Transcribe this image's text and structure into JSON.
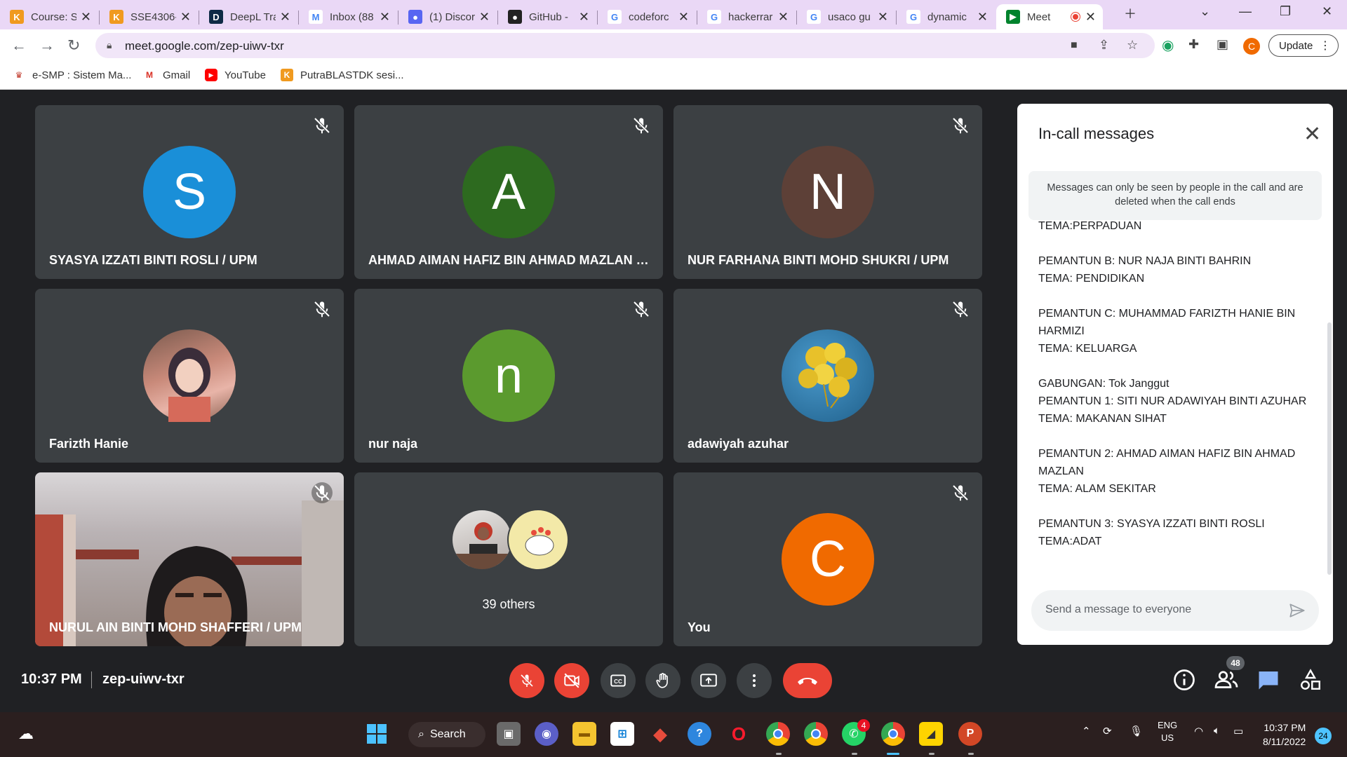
{
  "browser": {
    "tabs": [
      {
        "label": "Course: S",
        "favicon": "K",
        "color": "#f09a1f"
      },
      {
        "label": "SSE4306-",
        "favicon": "K",
        "color": "#f09a1f"
      },
      {
        "label": "DeepL Tra",
        "favicon": "D",
        "color": "#0f2b46"
      },
      {
        "label": "Inbox (88",
        "favicon": "M",
        "color": "#ffffff"
      },
      {
        "label": "(1) Discor",
        "favicon": "●",
        "color": "#5865f2"
      },
      {
        "label": "GitHub -",
        "favicon": "●",
        "color": "#222222"
      },
      {
        "label": "codeforc",
        "favicon": "G",
        "color": "#ffffff"
      },
      {
        "label": "hackerrar",
        "favicon": "G",
        "color": "#ffffff"
      },
      {
        "label": "usaco gu",
        "favicon": "G",
        "color": "#ffffff"
      },
      {
        "label": "dynamic",
        "favicon": "G",
        "color": "#ffffff"
      },
      {
        "label": "Meet",
        "favicon": "▶",
        "color": "#00832d"
      }
    ],
    "url": "meet.google.com/zep-uiwv-txr",
    "profile_initial": "C",
    "update_label": "Update",
    "bookmarks": [
      {
        "label": "e-SMP : Sistem Ma...",
        "icon": "esmp-icon"
      },
      {
        "label": "Gmail",
        "icon": "gmail-icon"
      },
      {
        "label": "YouTube",
        "icon": "youtube-icon"
      },
      {
        "label": "PutraBLASTDK sesi...",
        "icon": "putrablast-icon"
      }
    ]
  },
  "meet": {
    "participants": [
      {
        "name": "SYASYA IZZATI BINTI ROSLI / UPM",
        "initial": "S",
        "color": "#1a8fd8"
      },
      {
        "name": "AHMAD AIMAN HAFIZ BIN AHMAD MAZLAN / ...",
        "initial": "A",
        "color": "#2d6a1f"
      },
      {
        "name": "NUR FARHANA BINTI MOHD SHUKRI / UPM",
        "initial": "N",
        "color": "#5d4037"
      },
      {
        "name": "Farizth Hanie",
        "initial": "",
        "color": "#c98a7a"
      },
      {
        "name": "nur naja",
        "initial": "n",
        "color": "#5b9a2e"
      },
      {
        "name": "adawiyah azuhar",
        "initial": "",
        "color": "#3a7ea8"
      },
      {
        "name": "NURUL AIN BINTI MOHD SHAFFERI / UPM",
        "initial": "",
        "color": "#8a7f7a"
      },
      {
        "name": "39 others",
        "initial": "",
        "color": "#3c4043"
      },
      {
        "name": "You",
        "initial": "C",
        "color": "#f06a00"
      }
    ],
    "time": "10:37 PM",
    "code": "zep-uiwv-txr",
    "people_count": "48"
  },
  "chat": {
    "title": "In-call messages",
    "notice": "Messages can only be seen by people in the call and are deleted when the call ends",
    "messages": [
      "TEMA:PERPADUAN",
      "",
      "PEMANTUN B: NUR NAJA BINTI BAHRIN",
      "TEMA: PENDIDIKAN",
      "",
      "PEMANTUN C: MUHAMMAD FARIZTH HANIE BIN HARMIZI",
      "TEMA: KELUARGA",
      "",
      "GABUNGAN: Tok Janggut",
      "PEMANTUN 1: SITI NUR ADAWIYAH BINTI AZUHAR",
      "TEMA: MAKANAN SIHAT",
      "",
      "PEMANTUN 2: AHMAD AIMAN HAFIZ BIN AHMAD MAZLAN",
      "TEMA: ALAM SEKITAR",
      "",
      "PEMANTUN 3: SYASYA IZZATI BINTI ROSLI",
      "TEMA:ADAT"
    ],
    "placeholder": "Send a message to everyone"
  },
  "taskbar": {
    "search_label": "Search",
    "whatsapp_badge": "4",
    "lang_top": "ENG",
    "lang_bottom": "US",
    "time": "10:37 PM",
    "date": "8/11/2022",
    "notifications": "24"
  }
}
